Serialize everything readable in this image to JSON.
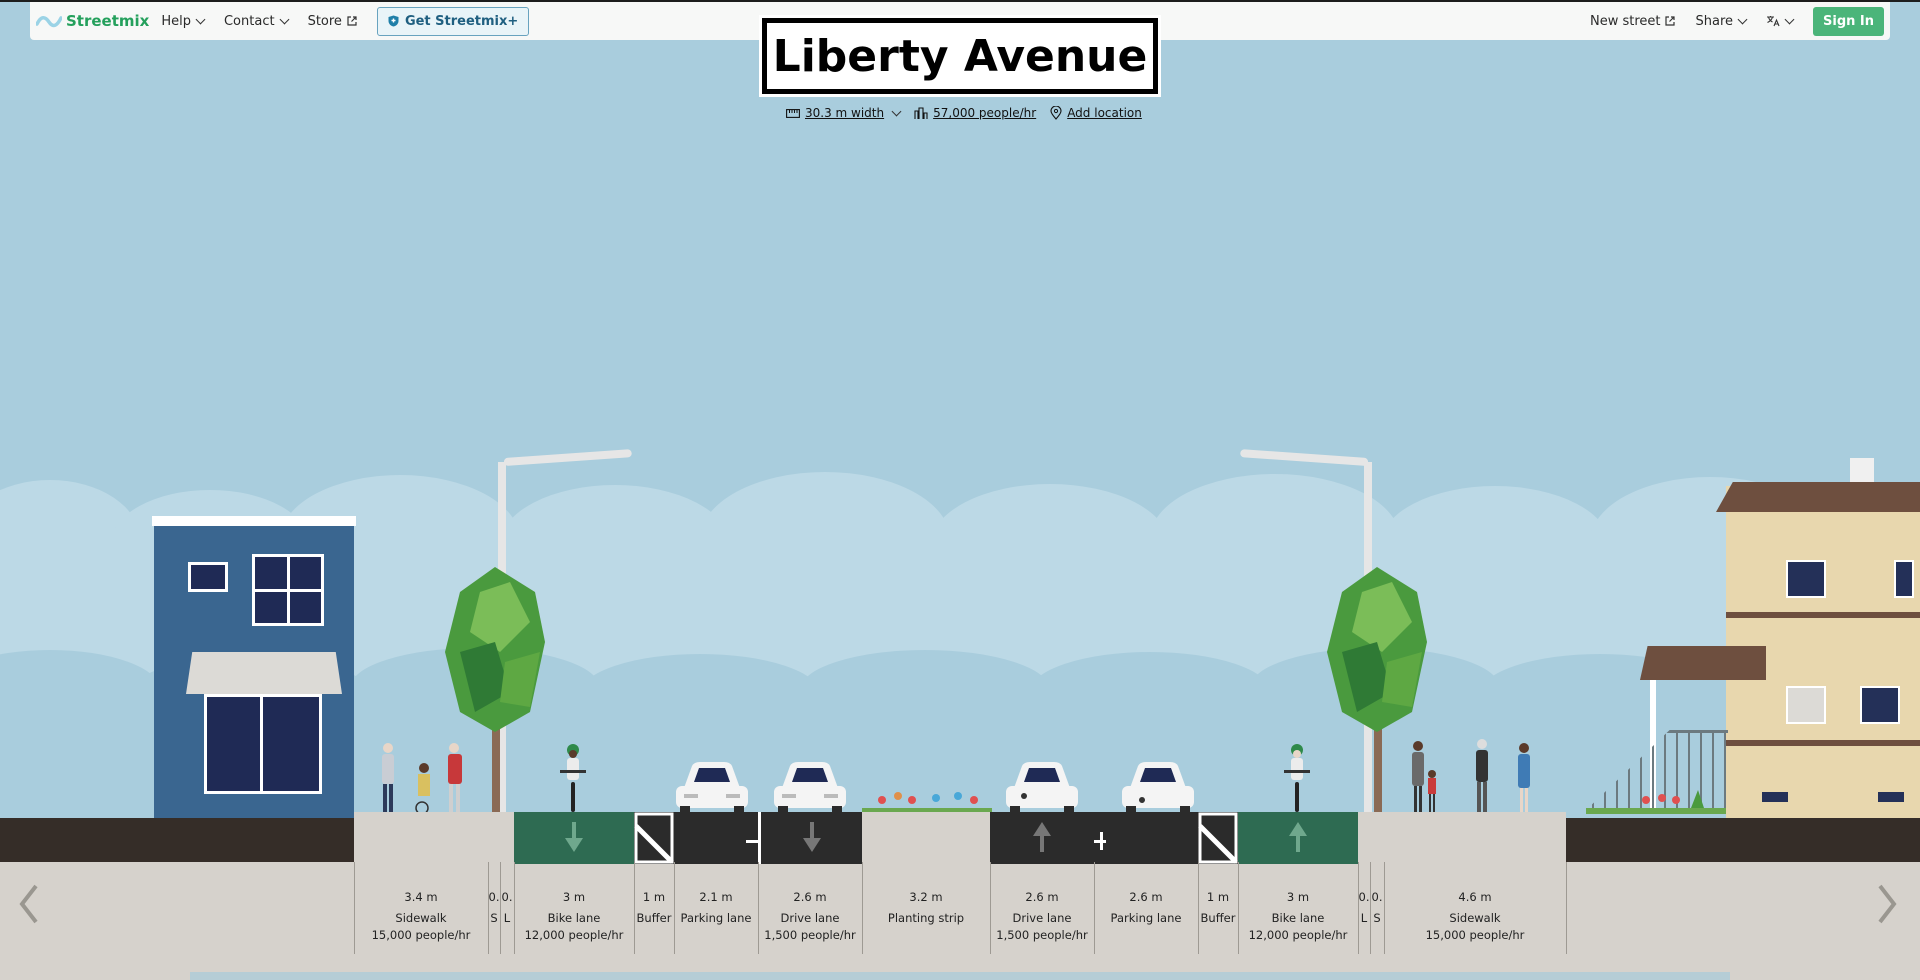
{
  "header": {
    "brand": "Streetmix",
    "menu": [
      {
        "label": "Help",
        "has_dropdown": true
      },
      {
        "label": "Contact",
        "has_dropdown": true
      },
      {
        "label": "Store",
        "external": true
      }
    ],
    "plus_button": "Get Streetmix+",
    "new_street": "New street",
    "share": "Share",
    "sign_in": "Sign In"
  },
  "street": {
    "title": "Liberty Avenue",
    "width": "30.3 m width",
    "capacity": "57,000 people/hr",
    "location": "Add location"
  },
  "segments": [
    {
      "width": "3.4 m",
      "name": "Sidewalk",
      "capacity": "15,000 people/hr"
    },
    {
      "width": "0.",
      "name": "S",
      "capacity": ""
    },
    {
      "width": "0.",
      "name": "L",
      "capacity": ""
    },
    {
      "width": "3 m",
      "name": "Bike lane",
      "capacity": "12,000 people/hr"
    },
    {
      "width": "1 m",
      "name": "Buffer",
      "capacity": ""
    },
    {
      "width": "2.1 m",
      "name": "Parking lane",
      "capacity": ""
    },
    {
      "width": "2.6 m",
      "name": "Drive lane",
      "capacity": "1,500 people/hr"
    },
    {
      "width": "3.2 m",
      "name": "Planting strip",
      "capacity": ""
    },
    {
      "width": "2.6 m",
      "name": "Drive lane",
      "capacity": "1,500 people/hr"
    },
    {
      "width": "2.6 m",
      "name": "Parking lane",
      "capacity": ""
    },
    {
      "width": "1 m",
      "name": "Buffer",
      "capacity": ""
    },
    {
      "width": "3 m",
      "name": "Bike lane",
      "capacity": "12,000 people/hr"
    },
    {
      "width": "0.",
      "name": "L",
      "capacity": ""
    },
    {
      "width": "0.",
      "name": "S",
      "capacity": ""
    },
    {
      "width": "4.6 m",
      "name": "Sidewalk",
      "capacity": "15,000 people/hr"
    }
  ],
  "colors": {
    "sky": "#a9cddd",
    "brand_green": "#24a05c",
    "bike_lane": "#2e6b52",
    "asphalt": "#2b2b2b",
    "sidewalk": "#d6d2cc",
    "ground": "#352d28",
    "blue_building": "#3a6690",
    "cream_house": "#e8d7ae"
  },
  "icons": [
    "streetmix-logo-icon",
    "ruler-icon",
    "people-icon",
    "location-pin-icon",
    "external-link-icon",
    "shield-plus-icon",
    "translate-icon",
    "chevron-left-icon",
    "chevron-right-icon"
  ]
}
